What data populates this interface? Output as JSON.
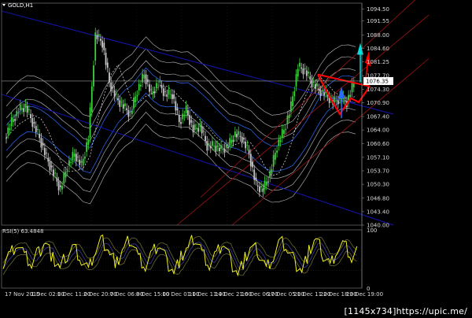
{
  "chart_data": [
    {
      "type": "line",
      "name": "price-panel",
      "symbol_label": "GOLD,H1",
      "ylim": [
        1040.0,
        1096.0
      ],
      "y_ticks": [
        "1094.50",
        "1091.55",
        "1088.00",
        "1084.60",
        "1081.25",
        "1077.70",
        "1074.30",
        "1070.90",
        "1067.40",
        "1064.00",
        "1060.60",
        "1057.10",
        "1053.70",
        "1050.30",
        "1046.80",
        "1043.40",
        "1040.00"
      ],
      "current_price": "1076.35",
      "x_ticks": [
        "17 Nov 2015",
        "1 Dec 02:00",
        "1 Dec 11:00",
        "2 Dec 20:00",
        "7 Dec 06:00",
        "8 Dec 15:00",
        "10 Dec 01:00",
        "11 Dec 11:00",
        "14 Dec 21:00",
        "16 Dec 06:00",
        "17 Dec 05:00",
        "21 Dec 11:00",
        "22 Dec 18:00",
        "23 Dec 19:00"
      ],
      "series": [
        {
          "values": [
            1062,
            1066,
            1069,
            1070,
            1066,
            1062,
            1057,
            1053,
            1049,
            1055,
            1058,
            1055,
            1062,
            1088,
            1086,
            1076,
            1072,
            1070,
            1068,
            1074,
            1078,
            1073,
            1076,
            1073,
            1073,
            1066,
            1069,
            1064,
            1065,
            1060,
            1060,
            1059,
            1060,
            1063,
            1062,
            1058,
            1050,
            1049,
            1053,
            1060,
            1064,
            1070,
            1080,
            1079,
            1076,
            1074,
            1073,
            1071,
            1072,
            1071,
            1076
          ]
        }
      ],
      "colors": {
        "candle_up": "#3cd23c",
        "candle_down": "#c8c8c8",
        "regression": "#1414b4",
        "channel": "#a01414",
        "bands": "#c0c0c0",
        "inner_bands": "#2a6cff",
        "signal": "#ff0000",
        "up_arrow": "#00e0e0"
      }
    },
    {
      "type": "line",
      "name": "RSI(5)",
      "label": "RSI(5) 63.4848",
      "ylim": [
        0,
        100
      ],
      "y_ticks": [
        "100",
        "0"
      ],
      "series": [
        {
          "values": [
            45,
            60,
            78,
            55,
            40,
            62,
            80,
            50,
            35,
            58,
            72,
            48,
            30,
            65,
            82,
            60,
            42,
            70,
            85,
            55,
            38,
            60,
            75,
            45,
            28,
            52,
            70,
            88,
            62,
            40,
            58,
            78,
            45,
            25,
            50,
            72,
            60,
            35,
            55,
            80,
            66,
            44,
            30,
            62,
            85,
            58,
            40,
            68,
            74,
            50,
            63
          ]
        }
      ]
    }
  ],
  "watermark": "[1145x734]https://upic.me/"
}
